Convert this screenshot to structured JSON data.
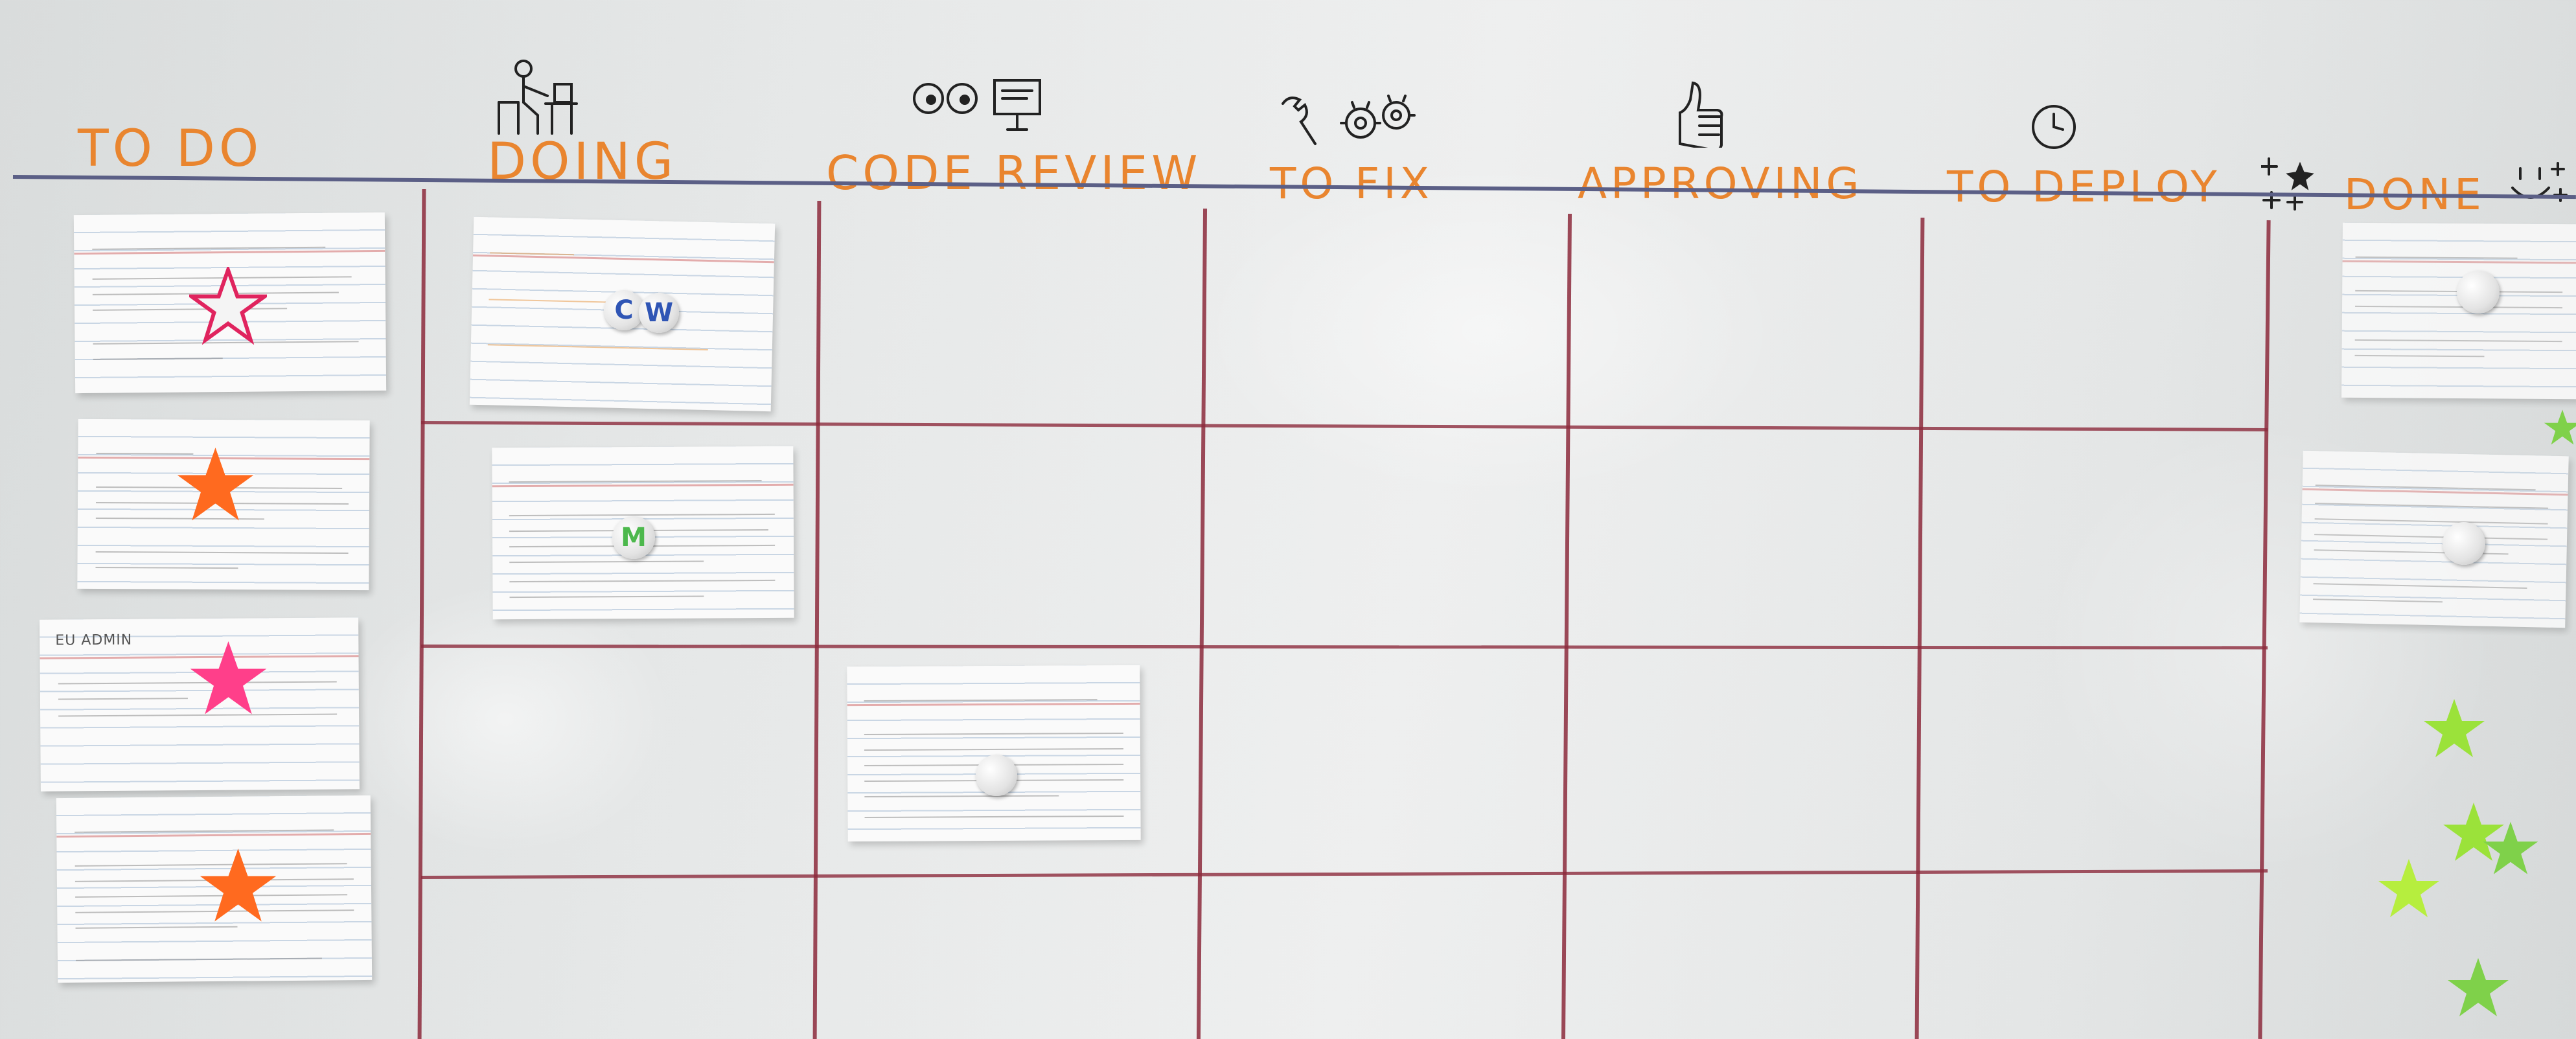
{
  "columns": [
    {
      "title": "TO DO"
    },
    {
      "title": "DOING"
    },
    {
      "title": "CODE REVIEW"
    },
    {
      "title": "TO FIX"
    },
    {
      "title": "APPROVING"
    },
    {
      "title": "TO DEPLOY"
    },
    {
      "title": "DONE"
    }
  ],
  "icons": {
    "doing": "person-at-desk-icon",
    "code_review": "eyes-and-monitor-icon",
    "to_fix": "wrench-and-gears-icon",
    "approving": "thumbs-up-icon",
    "to_deploy": "clock-icon",
    "done": "sparkle-and-smile-icon"
  },
  "cards": {
    "todo_3": {
      "title": "EU ADMIN"
    },
    "doing_1": {
      "magnet_label": "CW"
    },
    "doing_2": {
      "magnet_label": "M"
    }
  },
  "colors": {
    "header_text": "#e9852f",
    "grid_line": "#8c2a3c",
    "header_rule": "#5b5f86",
    "star_orange": "#ff6a1f",
    "star_pink": "#ff3f8a",
    "star_green": "#9be23a",
    "magnet_blue": "#2f55b5",
    "magnet_green": "#4cb84c"
  }
}
